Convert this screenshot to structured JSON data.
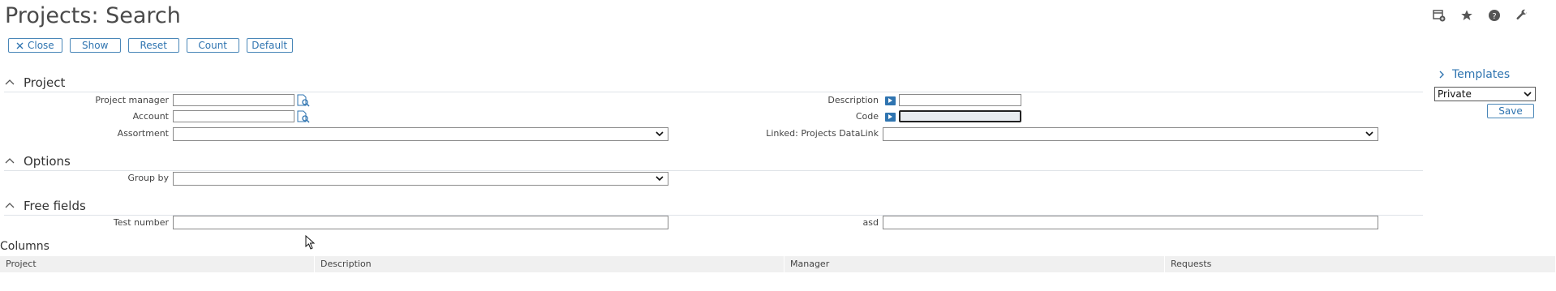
{
  "page": {
    "title": "Projects: Search"
  },
  "toolbar": {
    "close": "Close",
    "show": "Show",
    "reset": "Reset",
    "count": "Count",
    "default": "Default"
  },
  "top_icons": [
    "add-widget-icon",
    "star-icon",
    "help-icon",
    "wrench-icon"
  ],
  "sections": {
    "project": {
      "title": "Project",
      "project_manager": {
        "label": "Project manager",
        "value": ""
      },
      "account": {
        "label": "Account",
        "value": ""
      },
      "assortment": {
        "label": "Assortment",
        "value": ""
      },
      "description": {
        "label": "Description",
        "value": ""
      },
      "code": {
        "label": "Code",
        "value": ""
      },
      "linked": {
        "label": "Linked: Projects DataLink",
        "value": ""
      }
    },
    "options": {
      "title": "Options",
      "group_by": {
        "label": "Group by",
        "value": ""
      }
    },
    "free_fields": {
      "title": "Free fields",
      "test_number": {
        "label": "Test number",
        "value": ""
      },
      "asd": {
        "label": "asd",
        "value": ""
      }
    }
  },
  "templates": {
    "title": "Templates",
    "selected": "Private",
    "save": "Save"
  },
  "columns": {
    "title": "Columns",
    "headers": [
      "Project",
      "Description",
      "Manager",
      "Requests"
    ]
  },
  "colors": {
    "accent": "#2f74b0",
    "header_bg": "#f0f0f0"
  }
}
